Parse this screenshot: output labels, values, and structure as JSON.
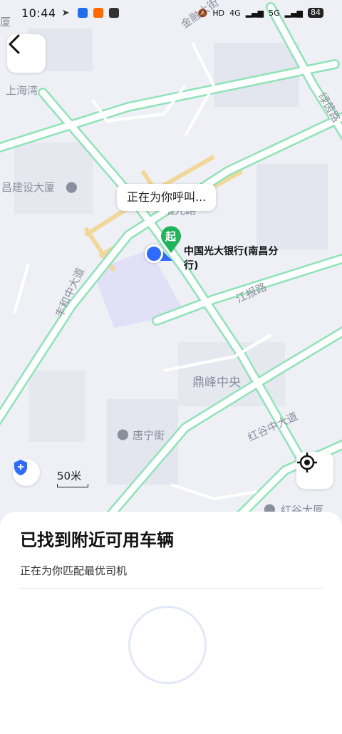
{
  "status_bar": {
    "time": "10:44",
    "network_labels": [
      "HD",
      "4G",
      "5G"
    ],
    "battery": "84"
  },
  "map": {
    "labels": {
      "hai_wan": "上海湾",
      "jian_she": "昌建设大厦",
      "feng_he": "丰和中大道",
      "jiang_bao": "江报路",
      "ding_feng": "鼎峰中央",
      "tang_ning": "唐宁街",
      "hong_gu_road": "红谷中大道",
      "hong_gu_building": "红谷大厦",
      "lv_yin": "绿茵路",
      "jin_sha": "金融大街",
      "sha": "厦",
      "guang_road": "祗光路"
    },
    "calling_bubble": "正在为你呼叫...",
    "start_marker": "起",
    "start_location": "中国光大银行(南昌分行)",
    "scale": "50米"
  },
  "icons": {
    "back": "back-arrow-icon",
    "shield": "shield-icon",
    "locate": "locate-icon"
  },
  "colors": {
    "road": "#8fe3b8",
    "accent": "#2f6bff",
    "pin": "#1fb35a"
  },
  "sheet": {
    "title": "已找到附近可用车辆",
    "subtitle": "正在为你匹配最优司机"
  }
}
